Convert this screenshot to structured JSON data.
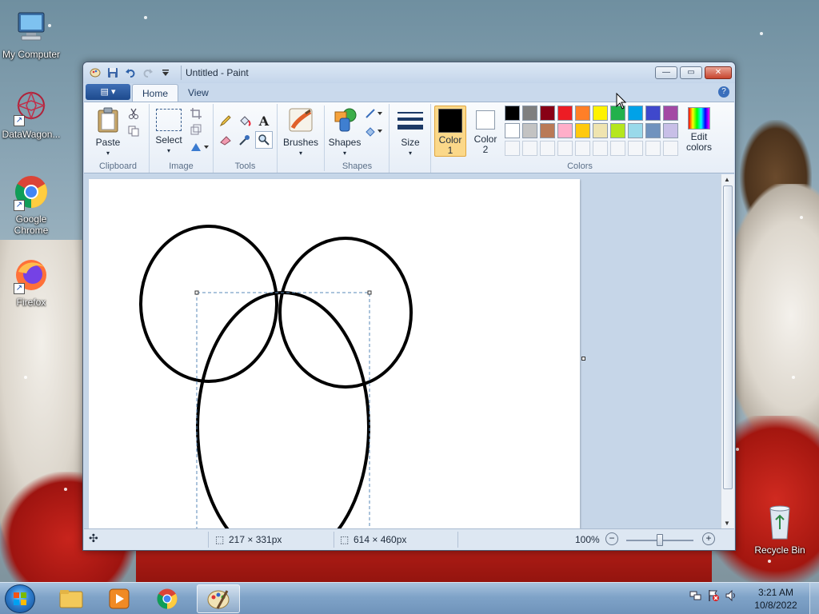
{
  "desktop": {
    "icons": [
      {
        "label": "My Computer"
      },
      {
        "label": "DataWagon..."
      },
      {
        "label": "Google Chrome"
      },
      {
        "label": "Firefox"
      },
      {
        "label": "Recycle Bin"
      }
    ]
  },
  "window": {
    "title": "Untitled - Paint",
    "controls": {
      "minimize": "—",
      "maximize": "▭",
      "close": "✕"
    }
  },
  "ribbon": {
    "app_menu": "▤ ▾",
    "tabs": [
      {
        "label": "Home",
        "active": true
      },
      {
        "label": "View",
        "active": false
      }
    ],
    "help": "?",
    "groups": {
      "clipboard": {
        "label": "Clipboard",
        "paste": "Paste"
      },
      "image": {
        "label": "Image",
        "select": "Select"
      },
      "tools": {
        "label": "Tools"
      },
      "brushes": {
        "label": "Brushes"
      },
      "shapes": {
        "label": "Shapes",
        "shapes_btn": "Shapes"
      },
      "size": {
        "label": "Size"
      },
      "colors": {
        "label": "Colors",
        "color1": "Color 1",
        "color2": "Color 2",
        "edit_colors": "Edit colors",
        "color1_value": "#000000",
        "color2_value": "#ffffff",
        "palette_row1": [
          "#000000",
          "#7f7f7f",
          "#880015",
          "#ed1c24",
          "#ff7f27",
          "#fff200",
          "#22b14c",
          "#00a2e8",
          "#3f48cc",
          "#a349a4"
        ],
        "palette_row2": [
          "#ffffff",
          "#c3c3c3",
          "#b97a57",
          "#ffaec9",
          "#ffc90e",
          "#efe4b0",
          "#b5e61d",
          "#99d9ea",
          "#7092be",
          "#c8bfe7"
        ]
      }
    }
  },
  "statusbar": {
    "selection_size": "217 × 331px",
    "image_size": "614 × 460px",
    "zoom": "100%",
    "zoom_level": 0.5
  },
  "taskbar": {
    "time": "3:21 AM",
    "date": "10/8/2022"
  }
}
